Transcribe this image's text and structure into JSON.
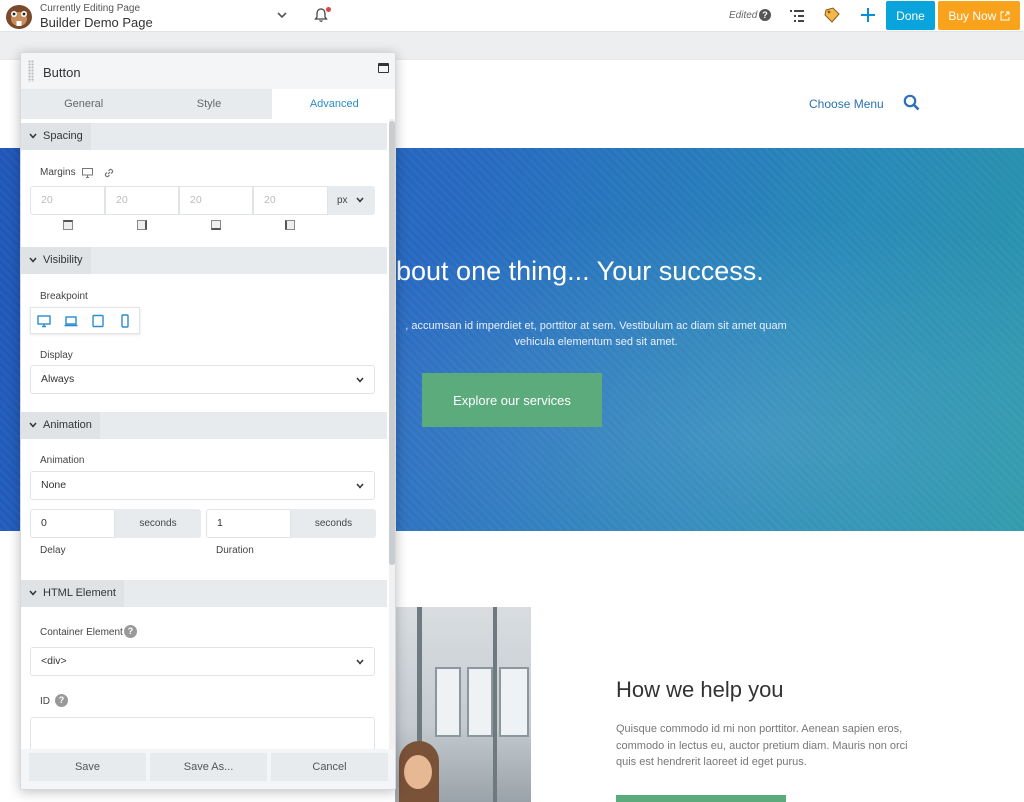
{
  "topbar": {
    "editing_label": "Currently Editing Page",
    "page_name": "Builder Demo Page",
    "edited_label": "Edited",
    "help_glyph": "?",
    "done_label": "Done",
    "buy_label": "Buy Now",
    "accent_done": "#0aa4dd",
    "accent_buy": "#f8a31b",
    "icons": [
      "beaver-logo-icon",
      "chevron-down-icon",
      "bell-icon",
      "help-icon",
      "outline-icon",
      "history-icon",
      "plus-icon",
      "external-link-icon"
    ]
  },
  "page": {
    "menu_label": "Choose Menu",
    "hero_title": "bout one thing... Your success.",
    "hero_text": ", accumsan id imperdiet et, porttitor at sem. Vestibulum ac diam sit amet quam vehicula elementum sed sit amet.",
    "hero_cta": "Explore our services",
    "help_title": "How we help you",
    "help_text": "Quisque commodo id mi non porttitor. Aenean sapien eros, commodo in lectus eu, auctor pretium diam. Mauris non orci quis est hendrerit laoreet id eget purus."
  },
  "panel": {
    "title": "Button",
    "tabs": [
      {
        "label": "General",
        "active": false
      },
      {
        "label": "Style",
        "active": false
      },
      {
        "label": "Advanced",
        "active": true
      }
    ],
    "spacing": {
      "heading": "Spacing",
      "margins_label": "Margins",
      "placeholders": [
        "20",
        "20",
        "20",
        "20"
      ],
      "unit": "px"
    },
    "visibility": {
      "heading": "Visibility",
      "breakpoint_label": "Breakpoint",
      "display_label": "Display",
      "display_value": "Always"
    },
    "animation": {
      "heading": "Animation",
      "animation_label": "Animation",
      "animation_value": "None",
      "delay_value": "0",
      "delay_unit": "seconds",
      "delay_label": "Delay",
      "duration_value": "1",
      "duration_unit": "seconds",
      "duration_label": "Duration"
    },
    "html_element": {
      "heading": "HTML Element",
      "container_label": "Container Element",
      "container_value": "<div>",
      "id_label": "ID",
      "id_value": ""
    },
    "footer": {
      "save_label": "Save",
      "save_as_label": "Save As...",
      "cancel_label": "Cancel"
    }
  }
}
